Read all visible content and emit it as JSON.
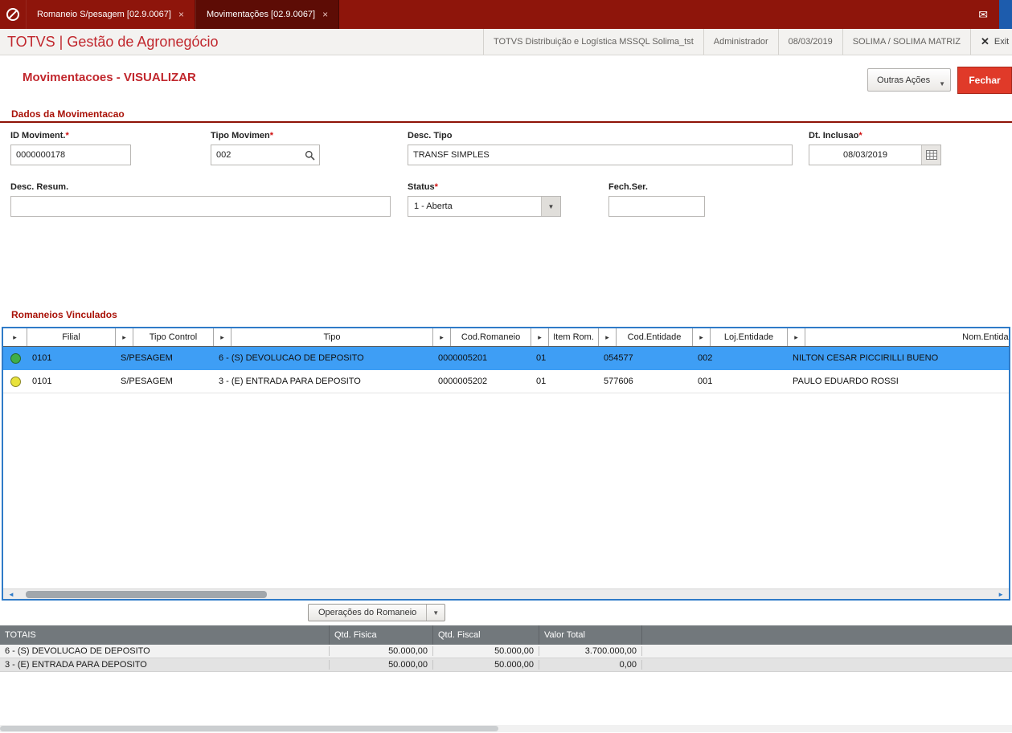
{
  "icons": {
    "sort": "▸",
    "dropdown": "▼",
    "close_tab": "×",
    "close_x": "✕",
    "mail": "✉",
    "scroll_left": "◄",
    "scroll_right": "►"
  },
  "colors": {
    "brand_red": "#c1272d",
    "topbar_red": "#8e150b",
    "selected_row_blue": "#3e9ef5",
    "status_green": "#3fae49",
    "status_yellow": "#e8e23c",
    "totals_header_gray": "#72787c"
  },
  "tabs": {
    "items": [
      {
        "label": "Romaneio S/pesagem [02.9.0067]"
      },
      {
        "label": "Movimentações [02.9.0067]"
      }
    ]
  },
  "header": {
    "brand": "TOTVS | Gestão de Agronegócio",
    "environment": "TOTVS Distribuição e Logística MSSQL Solima_tst",
    "user": "Administrador",
    "date": "08/03/2019",
    "company": "SOLIMA / SOLIMA MATRIZ",
    "exit_label": "Exit"
  },
  "page": {
    "title": "Movimentacoes - VISUALIZAR",
    "other_actions_label": "Outras Ações",
    "close_label": "Fechar"
  },
  "form": {
    "section_title": "Dados da Movimentacao",
    "fields": {
      "id_moviment": {
        "label": "ID Moviment.",
        "required": "*",
        "value": "0000000178"
      },
      "tipo_movimen": {
        "label": "Tipo Movimen",
        "required": "*",
        "value": "002"
      },
      "desc_tipo": {
        "label": "Desc. Tipo",
        "value": "TRANSF SIMPLES"
      },
      "dt_inclusao": {
        "label": "Dt. Inclusao",
        "required": "*",
        "value": "08/03/2019"
      },
      "desc_resum": {
        "label": "Desc. Resum.",
        "value": ""
      },
      "status": {
        "label": "Status",
        "required": "*",
        "value": "1 - Aberta"
      },
      "fech_ser": {
        "label": "Fech.Ser.",
        "value": ""
      }
    }
  },
  "grid": {
    "section_title": "Romaneios Vinculados",
    "columns": [
      "Filial",
      "Tipo Control",
      "Tipo",
      "Cod.Romaneio",
      "Item Rom.",
      "Cod.Entidade",
      "Loj.Entidade",
      "Nom.Entidade"
    ],
    "rows": [
      {
        "status_color": "#3fae49",
        "filial": "0101",
        "tipo_control": "S/PESAGEM",
        "tipo": "6 - (S) DEVOLUCAO DE DEPOSITO",
        "cod_romaneio": "0000005201",
        "item_rom": "01",
        "cod_entidade": "054577",
        "loj_entidade": "002",
        "nom_entidade": "NILTON CESAR PICCIRILLI BUENO"
      },
      {
        "status_color": "#e8e23c",
        "filial": "0101",
        "tipo_control": "S/PESAGEM",
        "tipo": "3 - (E) ENTRADA PARA DEPOSITO",
        "cod_romaneio": "0000005202",
        "item_rom": "01",
        "cod_entidade": "577606",
        "loj_entidade": "001",
        "nom_entidade": "PAULO EDUARDO ROSSI"
      }
    ],
    "operations_button": "Operações do Romaneio"
  },
  "totals": {
    "headers": [
      "TOTAIS",
      "Qtd. Fisica",
      "Qtd. Fiscal",
      "Valor Total"
    ],
    "rows": [
      {
        "label": "6 - (S) DEVOLUCAO DE DEPOSITO",
        "qtd_fisica": "50.000,00",
        "qtd_fiscal": "50.000,00",
        "valor_total": "3.700.000,00"
      },
      {
        "label": "3 - (E) ENTRADA PARA DEPOSITO",
        "qtd_fisica": "50.000,00",
        "qtd_fiscal": "50.000,00",
        "valor_total": "0,00"
      }
    ]
  }
}
